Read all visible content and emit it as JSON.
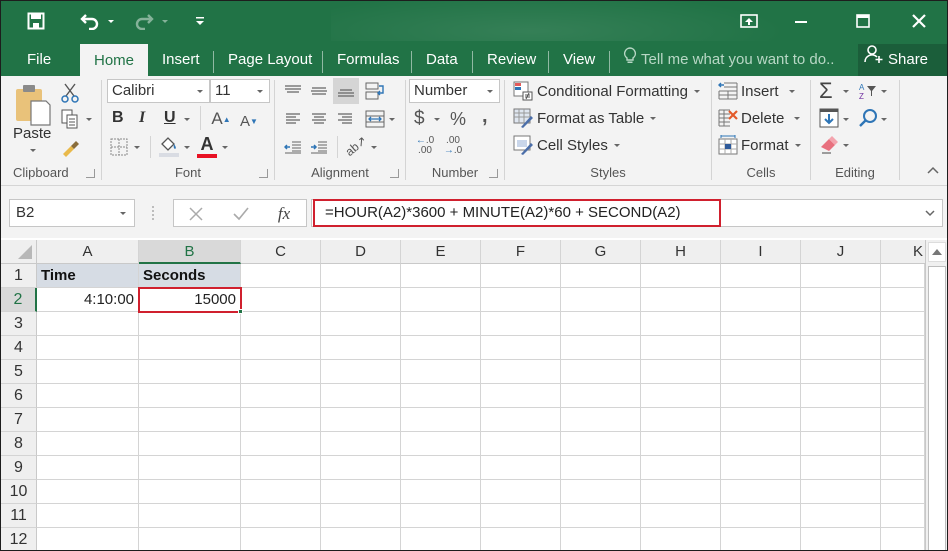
{
  "title_bar": {
    "quick_access": [
      {
        "name": "save-icon"
      },
      {
        "name": "undo-icon"
      },
      {
        "name": "redo-icon"
      },
      {
        "name": "customize-qat-icon"
      }
    ],
    "window_controls": [
      "ribbon-display-options-icon",
      "minimize-icon",
      "maximize-icon",
      "close-icon"
    ]
  },
  "tabs": {
    "items": [
      {
        "label": "File"
      },
      {
        "label": "Home",
        "active": true
      },
      {
        "label": "Insert"
      },
      {
        "label": "Page Layout"
      },
      {
        "label": "Formulas"
      },
      {
        "label": "Data"
      },
      {
        "label": "Review"
      },
      {
        "label": "View"
      }
    ],
    "tell_me": "Tell me what you want to do..",
    "share": "Share"
  },
  "ribbon": {
    "clipboard": {
      "label": "Clipboard",
      "paste": "Paste"
    },
    "font": {
      "label": "Font",
      "font_name": "Calibri",
      "font_size": "11",
      "bold": "B",
      "italic": "I",
      "underline": "U",
      "font_color": "#e81123"
    },
    "alignment": {
      "label": "Alignment"
    },
    "number": {
      "label": "Number",
      "format": "Number",
      "currency": "$",
      "percent": "%",
      "comma": ","
    },
    "styles": {
      "label": "Styles",
      "conditional_formatting": "Conditional Formatting",
      "format_as_table": "Format as Table",
      "cell_styles": "Cell Styles"
    },
    "cells": {
      "label": "Cells",
      "insert": "Insert",
      "delete": "Delete",
      "format": "Format"
    },
    "editing": {
      "label": "Editing",
      "sum": "Σ"
    }
  },
  "formula_bar": {
    "name_box": "B2",
    "fx": "fx",
    "formula": "=HOUR(A2)*3600 + MINUTE(A2)*60 + SECOND(A2)"
  },
  "sheet": {
    "columns": [
      "A",
      "B",
      "C",
      "D",
      "E",
      "F",
      "G",
      "H",
      "I",
      "J",
      "K"
    ],
    "rows": [
      "1",
      "2",
      "3",
      "4",
      "5",
      "6",
      "7",
      "8",
      "9",
      "10",
      "11",
      "12"
    ],
    "selected_cell": "B2",
    "cells": {
      "A1": "Time",
      "B1": "Seconds",
      "A2": "4:10:00",
      "B2": "15000"
    }
  },
  "colors": {
    "accent": "#217346",
    "highlight": "#d0202e",
    "header_fill": "#d6dce4"
  }
}
